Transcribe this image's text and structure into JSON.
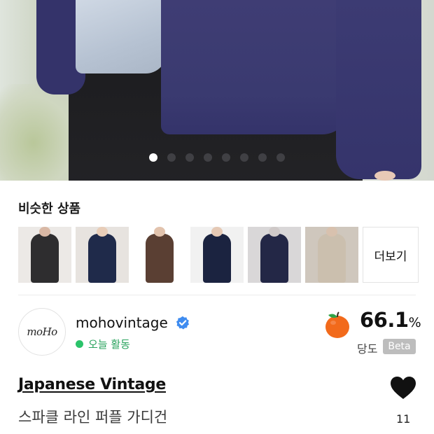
{
  "hero": {
    "slides_total": 8,
    "active_slide": 1
  },
  "similar": {
    "title": "비슷한 상품",
    "more_label": "더보기",
    "items": [
      {
        "name": "similar-item-1",
        "bg": "#ece9e6",
        "garment": "#2e2d2f",
        "skin": "#d9b8a5"
      },
      {
        "name": "similar-item-2",
        "bg": "#e7e3df",
        "garment": "#1f2a4a",
        "skin": "#e8cdb8"
      },
      {
        "name": "similar-item-3",
        "bg": "#ffffff",
        "garment": "#5a3f33",
        "skin": "#e2c3ad"
      },
      {
        "name": "similar-item-4",
        "bg": "#f1f1f1",
        "garment": "#1b2340",
        "skin": "#e5c9b5"
      },
      {
        "name": "similar-item-5",
        "bg": "#d9d7d8",
        "garment": "#232746",
        "skin": "#cfc9c8"
      },
      {
        "name": "similar-item-6",
        "bg": "#cfc7bd",
        "garment": "#cbbfae",
        "skin": "#d8c1ae"
      }
    ]
  },
  "seller": {
    "avatar_text": "moHo",
    "name": "mohovintage",
    "status": "오늘 활동",
    "rating_value": "66.1",
    "rating_unit": "%",
    "rating_label": "당도",
    "beta_label": "Beta"
  },
  "product": {
    "brand": "Japanese Vintage",
    "name": "스파클 라인 퍼플 가디건",
    "likes": "11"
  },
  "colors": {
    "accent_green": "#2bc36a",
    "verified_blue": "#3f8cf0",
    "apple_orange": "#f26a1b"
  }
}
